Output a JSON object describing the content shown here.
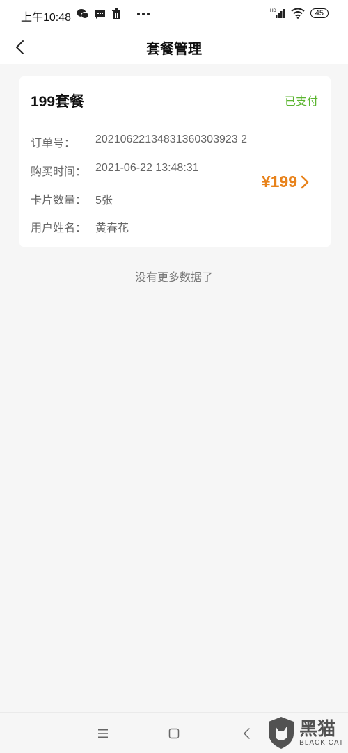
{
  "status_bar": {
    "time": "上午10:48",
    "left_icons": [
      "wechat-icon",
      "message-icon",
      "trash-icon",
      "more-dots-icon"
    ],
    "right_icons": [
      "hd-signal-icon",
      "wifi-icon"
    ],
    "battery": "45"
  },
  "header": {
    "title": "套餐管理"
  },
  "card": {
    "package_name": "199套餐",
    "status": "已支付",
    "rows": [
      {
        "label": "订单号：",
        "value": "20210622134831360303923 2"
      },
      {
        "label": "购买时间：",
        "value": "2021-06-22 13:48:31"
      },
      {
        "label": "卡片数量：",
        "value": "5张"
      },
      {
        "label": "用户姓名：",
        "value": "黄春花"
      }
    ],
    "price": "¥199"
  },
  "footer": {
    "no_more": "没有更多数据了"
  },
  "watermark": {
    "cn": "黑猫",
    "en": "BLACK CAT"
  },
  "colors": {
    "status_paid": "#5cb531",
    "price": "#e8821a"
  }
}
